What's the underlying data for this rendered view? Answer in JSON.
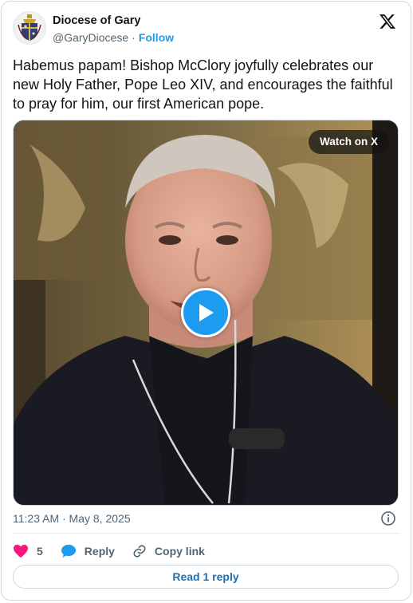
{
  "author": {
    "name": "Diocese of Gary",
    "handle": "@GaryDiocese",
    "separator": "·",
    "follow_label": "Follow"
  },
  "tweet": {
    "text": "Habemus papam! Bishop McClory joyfully celebrates our new Holy Father, Pope Leo XIV, and encourages the faithful to pray for him, our first American pope."
  },
  "media": {
    "watch_label": "Watch on X"
  },
  "meta": {
    "timestamp": "11:23 AM · May 8, 2025"
  },
  "actions": {
    "like_count": "5",
    "reply_label": "Reply",
    "copy_label": "Copy link"
  },
  "footer": {
    "read_replies_label": "Read 1 reply"
  },
  "colors": {
    "accent": "#1d9bf0",
    "like": "#f91880",
    "text": "#0f1419",
    "muted": "#536471"
  }
}
